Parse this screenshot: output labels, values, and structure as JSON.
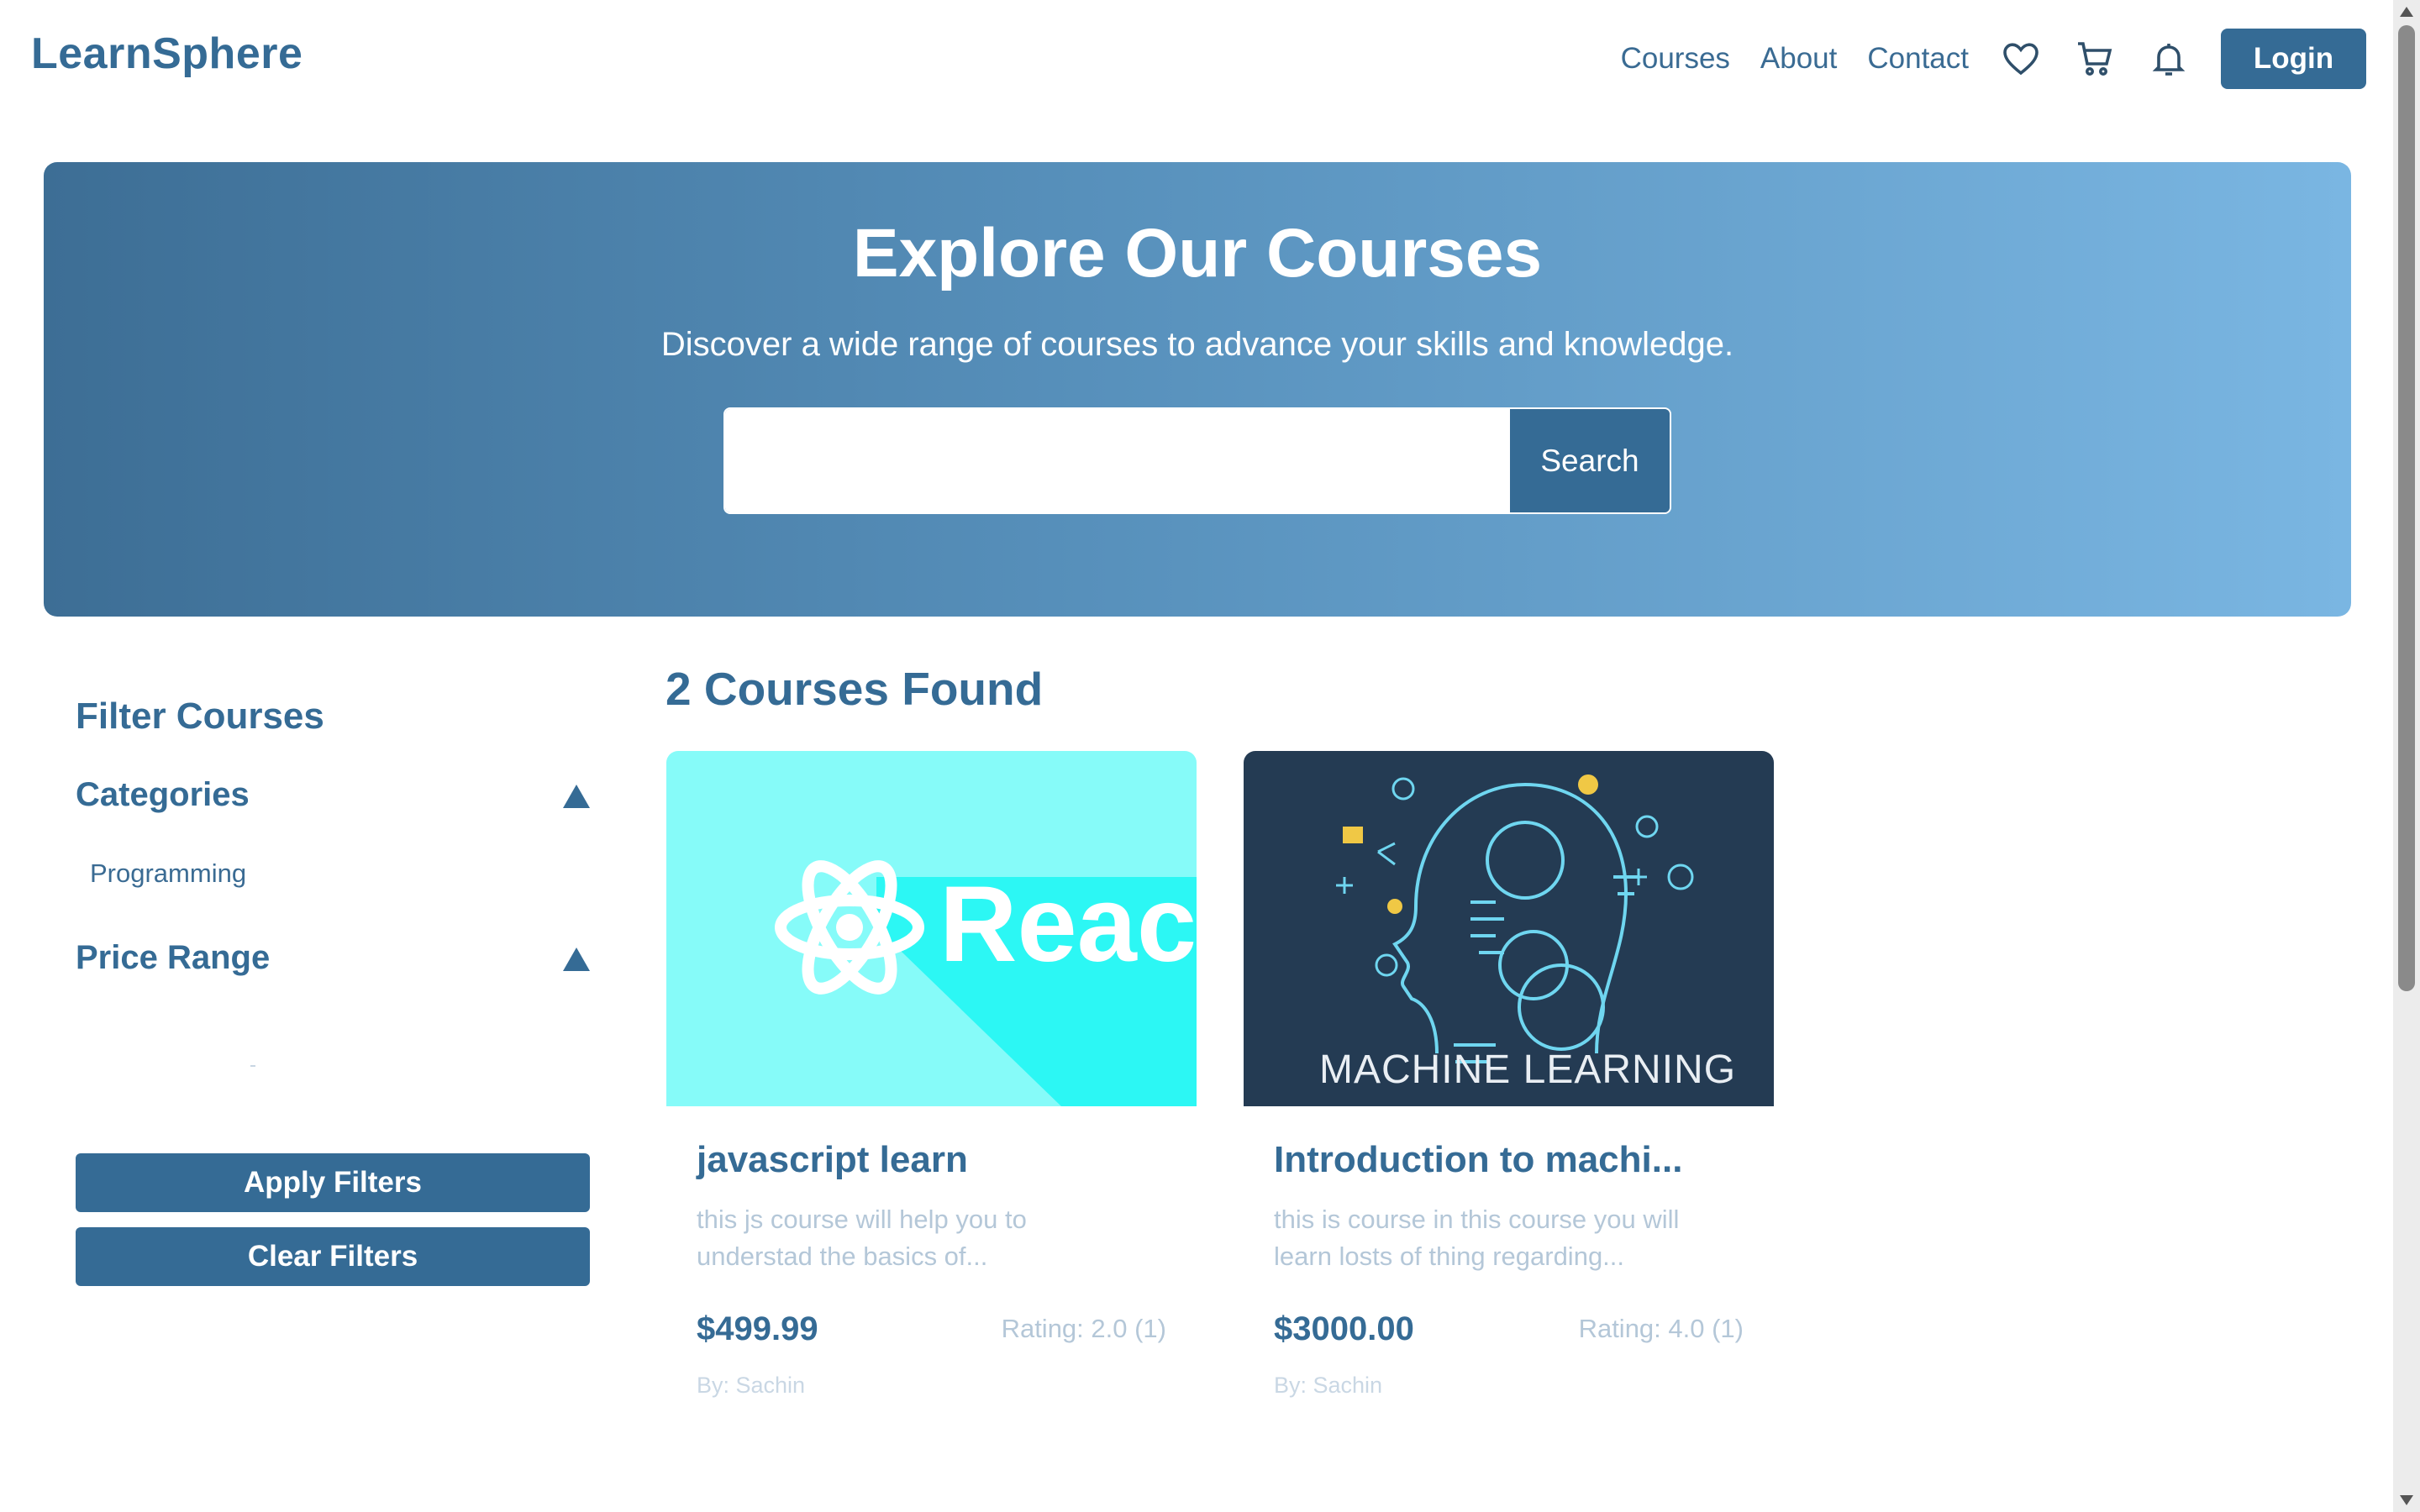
{
  "header": {
    "brand": "LearnSphere",
    "nav": [
      "Courses",
      "About",
      "Contact"
    ],
    "icons": [
      "heart-icon",
      "cart-icon",
      "bell-icon"
    ],
    "login_label": "Login"
  },
  "hero": {
    "title": "Explore Our Courses",
    "subtitle": "Discover a wide range of courses to advance your skills and knowledge.",
    "search": {
      "placeholder": "",
      "value": "",
      "button_label": "Search"
    }
  },
  "sidebar": {
    "title": "Filter Courses",
    "categories": {
      "label": "Categories",
      "items": [
        "Programming"
      ]
    },
    "price_range": {
      "label": "Price Range"
    },
    "apply_label": "Apply Filters",
    "clear_label": "Clear Filters"
  },
  "results": {
    "heading": "2 Courses Found",
    "courses": [
      {
        "title": "javascript learn",
        "description": "this js course will help you to understad the basics of...",
        "price": "$499.99",
        "rating": "Rating: 2.0 (1)",
        "author": "By: Sachin",
        "image_text": "Reac"
      },
      {
        "title": "Introduction to machi...",
        "description": "this is course in this course you will learn losts of thing regarding...",
        "price": "$3000.00",
        "rating": "Rating: 4.0 (1)",
        "author": "By: Sachin",
        "image_text": "MACHINE LEARNING"
      }
    ]
  },
  "colors": {
    "primary": "#356b95",
    "hero_gradient_start": "#3d6e95",
    "hero_gradient_end": "#7ab6e2",
    "react_bg": "#86fbf9",
    "ml_bg": "#243b53"
  }
}
